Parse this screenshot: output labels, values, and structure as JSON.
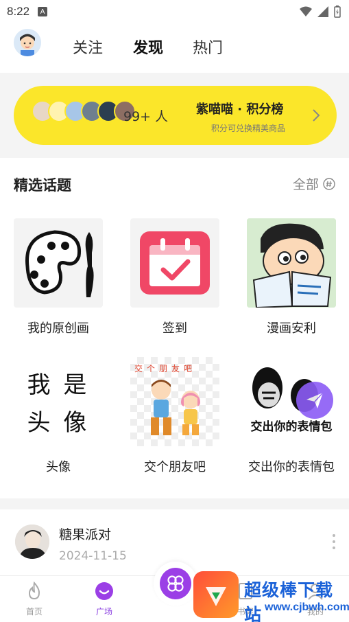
{
  "status": {
    "time": "8:22",
    "indicator": "A"
  },
  "header": {
    "tabs": [
      {
        "label": "关注"
      },
      {
        "label": "发现"
      },
      {
        "label": "热门"
      }
    ]
  },
  "banner": {
    "count": "99+ 人",
    "title": "紫喵喵 · 积分榜",
    "subtitle": "积分可兑换精美商品"
  },
  "topics": {
    "title": "精选话题",
    "see_all": "全部",
    "items": [
      {
        "label": "我的原创画"
      },
      {
        "label": "签到"
      },
      {
        "label": "漫画安利"
      },
      {
        "label": "头像",
        "art_text_1": "我 是",
        "art_text_2": "头 像"
      },
      {
        "label": "交个朋友吧",
        "art_text": "交个朋友吧"
      },
      {
        "label": "交出你的表情包",
        "art_text": "交出你的表情包"
      }
    ]
  },
  "post": {
    "name": "糖果派对",
    "date": "2024-11-15"
  },
  "nav": {
    "items": [
      {
        "label": "首页"
      },
      {
        "label": "广场"
      },
      {
        "label": "书架"
      },
      {
        "label": "我的"
      }
    ]
  },
  "watermark": {
    "title": "超级棒下载站",
    "url": "www.cjbwh.com"
  },
  "colors": {
    "accent": "#9b3fe6",
    "banner": "#fbe62a",
    "watermark": "#1b62d8"
  }
}
